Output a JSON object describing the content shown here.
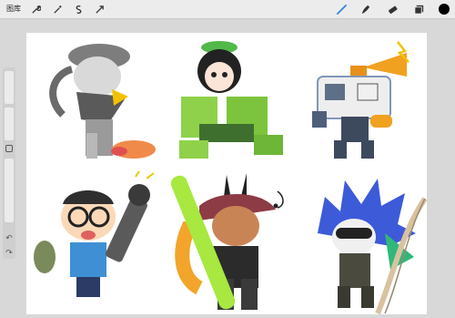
{
  "topbar": {
    "gallery_label": "图库",
    "tools_left": [
      "wrench-icon",
      "magic-wand-icon",
      "selection-icon",
      "transform-arrow-icon"
    ],
    "tools_right": [
      "brush-icon",
      "smudge-icon",
      "eraser-icon",
      "layers-icon",
      "color-swatch-icon"
    ],
    "active_tool": "brush",
    "accent_color": "#2f80ed",
    "current_color": "#000000"
  },
  "sidebar": {
    "undo_glyph": "↶",
    "redo_glyph": "↷"
  },
  "canvas": {
    "background": "#ffffff",
    "artwork": [
      "chibi-knight-hat",
      "chibi-green-mech-girl",
      "chibi-robot-megaphone",
      "chibi-boy-cannon",
      "chibi-bunny-bazooka",
      "chibi-blue-hair-blade"
    ]
  }
}
